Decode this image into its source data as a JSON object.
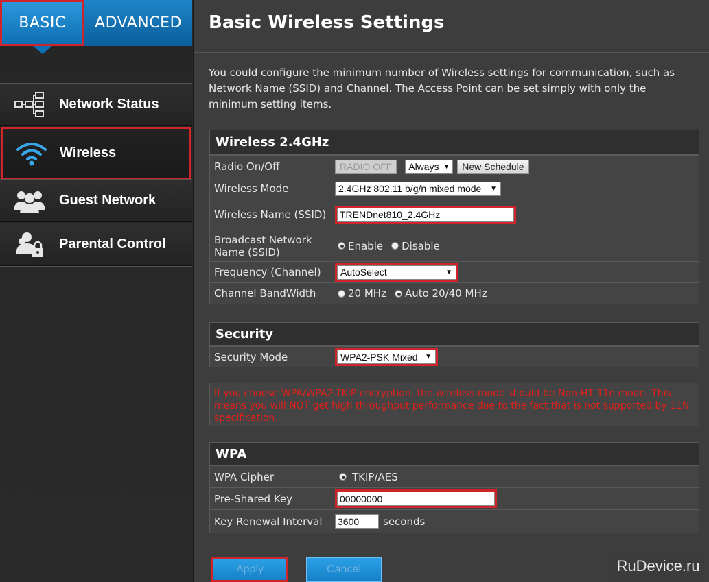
{
  "tabs": {
    "basic": "BASIC",
    "advanced": "ADVANCED"
  },
  "nav": [
    {
      "label": "Network Status",
      "icon": "network-tree-icon"
    },
    {
      "label": "Wireless",
      "icon": "wifi-icon"
    },
    {
      "label": "Guest Network",
      "icon": "users-icon"
    },
    {
      "label": "Parental Control",
      "icon": "user-lock-icon"
    }
  ],
  "page": {
    "title": "Basic Wireless Settings",
    "intro": "You could configure the minimum number of Wireless settings for communication, such as Network Name (SSID) and Channel. The Access Point can be set simply with only the minimum setting items."
  },
  "wireless": {
    "header": "Wireless 2.4GHz",
    "radio_label": "Radio On/Off",
    "radio_button": "RADIO OFF",
    "schedule_value": "Always",
    "new_schedule": "New Schedule",
    "mode_label": "Wireless Mode",
    "mode_value": "2.4GHz 802.11 b/g/n mixed mode",
    "name_label": "Wireless Name (SSID)",
    "name_value": "TRENDnet810_2.4GHz",
    "broadcast_label": "Broadcast Network Name (SSID)",
    "broadcast_enable": "Enable",
    "broadcast_disable": "Disable",
    "freq_label": "Frequency (Channel)",
    "freq_value": "AutoSelect",
    "bw_label": "Channel BandWidth",
    "bw_20": "20 MHz",
    "bw_auto": "Auto 20/40 MHz"
  },
  "security": {
    "header": "Security",
    "mode_label": "Security Mode",
    "mode_value": "WPA2-PSK Mixed"
  },
  "warning": "If you choose WPA/WPA2-TKIP encryption, the wireless mode should be Non-HT 11n mode. This means you will NOT get high throughput performance due to the fact that is not supported by 11N specification.",
  "wpa": {
    "header": "WPA",
    "cipher_label": "WPA Cipher",
    "cipher_value": "TKIP/AES",
    "psk_label": "Pre-Shared Key",
    "psk_value": "00000000",
    "renewal_label": "Key Renewal Interval",
    "renewal_value": "3600",
    "renewal_unit": "seconds"
  },
  "buttons": {
    "apply": "Apply",
    "cancel": "Cancel"
  },
  "watermark": "RuDevice.ru",
  "colors": {
    "accent_blue": "#1a86cc",
    "highlight_red": "#d0232a",
    "warning_red": "#e0201a"
  }
}
